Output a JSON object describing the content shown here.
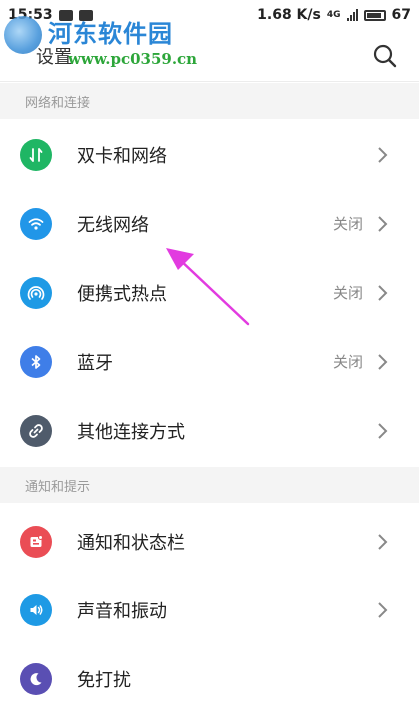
{
  "status_bar": {
    "time": "15:53",
    "network_speed": "1.68 K/s",
    "network_type": "4G",
    "battery": "67"
  },
  "watermark": {
    "title": "河东软件园",
    "url": "www.pc0359.cn"
  },
  "header": {
    "title": "设置",
    "search_icon": "search-icon"
  },
  "sections": [
    {
      "title": "网络和连接",
      "items": [
        {
          "label": "双卡和网络",
          "value": "",
          "icon": "dual-sim-icon",
          "color": "#1fb664"
        },
        {
          "label": "无线网络",
          "value": "关闭",
          "icon": "wifi-icon",
          "color": "#2196e8"
        },
        {
          "label": "便携式热点",
          "value": "关闭",
          "icon": "hotspot-icon",
          "color": "#1e9ae5"
        },
        {
          "label": "蓝牙",
          "value": "关闭",
          "icon": "bluetooth-icon",
          "color": "#3f7ee8"
        },
        {
          "label": "其他连接方式",
          "value": "",
          "icon": "link-icon",
          "color": "#4f5b6b"
        }
      ]
    },
    {
      "title": "通知和提示",
      "items": [
        {
          "label": "通知和状态栏",
          "value": "",
          "icon": "notification-icon",
          "color": "#ea4d55"
        },
        {
          "label": "声音和振动",
          "value": "",
          "icon": "sound-icon",
          "color": "#1e9ae5"
        },
        {
          "label": "免打扰",
          "value": "",
          "icon": "moon-icon",
          "color": "#5a4fb3"
        }
      ]
    }
  ],
  "colors": {
    "accent": "#2196e8",
    "annotation_arrow": "#e23be0",
    "section_bg": "#f4f4f4"
  }
}
